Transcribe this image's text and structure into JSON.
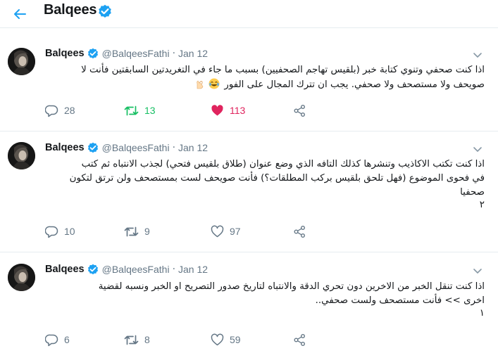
{
  "header": {
    "title": "Balqees"
  },
  "tweets": [
    {
      "name": "Balqees",
      "handle": "@BalqeesFathi",
      "separator": "·",
      "date": "Jan 12",
      "lines": [
        "اذا كنت صحفي وتنوي كتابة خبر (بلقيس تهاجم الصحفيين) بسبب ما جاء في التغريدتين السابقتين فأنت لا",
        "صويحف ولا مستصحف ولا صحفي. يجب ان تترك المجال على الفور"
      ],
      "reply": "28",
      "retweet": "13",
      "like": "113",
      "retweeted": true,
      "liked": true
    },
    {
      "name": "Balqees",
      "handle": "@BalqeesFathi",
      "separator": "·",
      "date": "Jan 12",
      "lines": [
        "اذا كنت تكتب الاكاذيب وتنشرها كذلك التافه الذي وضع عنوان (طلاق بلقيس فتحي) لجذب الانتباه ثم كتب",
        "في فحوى الموضوع (فهل تلحق بلقيس بركب المطلقات؟) فأنت صويحف لست بمستصحف ولن ترتق لتكون",
        "صحفيا",
        "٢"
      ],
      "reply": "10",
      "retweet": "9",
      "like": "97",
      "retweeted": false,
      "liked": false
    },
    {
      "name": "Balqees",
      "handle": "@BalqeesFathi",
      "separator": "·",
      "date": "Jan 12",
      "lines": [
        "اذا كنت تنقل الخبر من الاخرين دون تحري الدقة والانتباه لتاريخ صدور التصريح او الخبر ونسبه لقضية",
        "اخرى >> فأنت مستصحف ولست صحفي..",
        "١"
      ],
      "reply": "6",
      "retweet": "8",
      "like": "59",
      "retweeted": false,
      "liked": false
    }
  ],
  "colors": {
    "accent": "#1da1f2",
    "retweet_active": "#17bf63",
    "like_active": "#e0245e",
    "muted": "#657786",
    "text": "#14171a",
    "divider": "#e6ecf0"
  },
  "icons": [
    "back-arrow-icon",
    "verified-badge-icon",
    "avatar",
    "chevron-down-icon",
    "reply-icon",
    "retweet-icon",
    "like-icon",
    "share-icon",
    "laughing-emoji",
    "ok-hand-emoji"
  ]
}
